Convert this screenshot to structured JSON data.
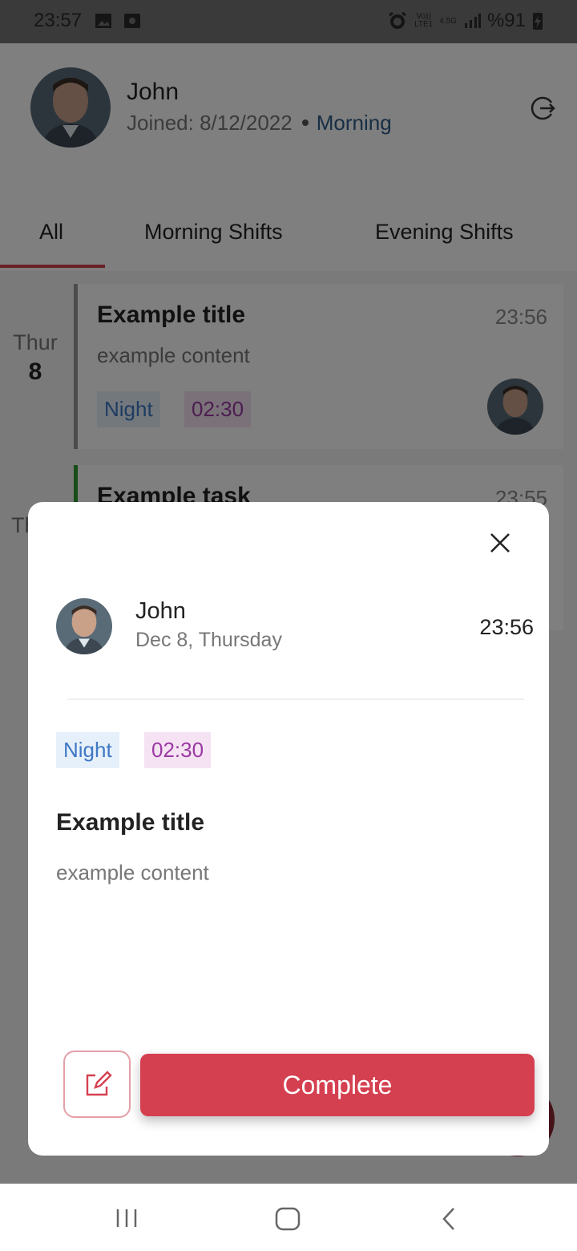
{
  "status_bar": {
    "time": "23:57",
    "battery": "%91",
    "network_labels": [
      "Vo))",
      "LTE1",
      "4.5G"
    ]
  },
  "profile": {
    "name": "John",
    "joined": "Joined: 8/12/2022",
    "shift": "Morning"
  },
  "tabs": [
    {
      "label": "All",
      "active": true
    },
    {
      "label": "Morning Shifts",
      "active": false
    },
    {
      "label": "Evening Shifts",
      "active": false
    }
  ],
  "list": {
    "days": [
      {
        "weekday": "Thur",
        "day": "8"
      },
      {
        "weekday": "Th",
        "day": ""
      }
    ],
    "cards": [
      {
        "title": "Example title",
        "content": "example content",
        "time": "23:56",
        "tags": [
          "Night",
          "02:30"
        ],
        "accent": "#999999"
      },
      {
        "title": "Example task",
        "time": "23:55",
        "accent": "#2f9a2f"
      }
    ]
  },
  "modal": {
    "name": "John",
    "date": "Dec 8, Thursday",
    "time": "23:56",
    "tags": [
      "Night",
      "02:30"
    ],
    "title": "Example title",
    "content": "example content",
    "complete_label": "Complete"
  },
  "colors": {
    "accent": "#d54050",
    "night_tag": "#3f78c5",
    "time_tag": "#9a3aa3"
  }
}
